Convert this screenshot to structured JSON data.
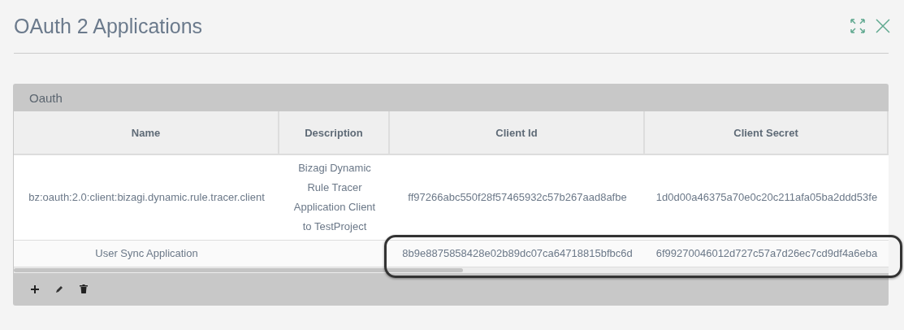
{
  "window": {
    "title": "OAuth 2 Applications"
  },
  "panel": {
    "title": "Oauth"
  },
  "table": {
    "columns": [
      "Name",
      "Description",
      "Client Id",
      "Client Secret"
    ],
    "rows": [
      {
        "cells": [
          "bz:oauth:2.0:client:bizagi.dynamic.rule.tracer.client",
          "Bizagi Dynamic Rule Tracer Application Client to TestProject",
          "ff97266abc550f28f57465932c57b267aad8afbe",
          "1d0d00a46375a70e0c20c211afa05ba2ddd53fe"
        ],
        "highlighted": false
      },
      {
        "cells": [
          "User Sync Application",
          "",
          "8b9e8875858428e02b89dc07ca64718815bfbc6d",
          "6f99270046012d727c57a7d26ec7cd9df4a6eba"
        ],
        "highlighted": true
      }
    ]
  }
}
